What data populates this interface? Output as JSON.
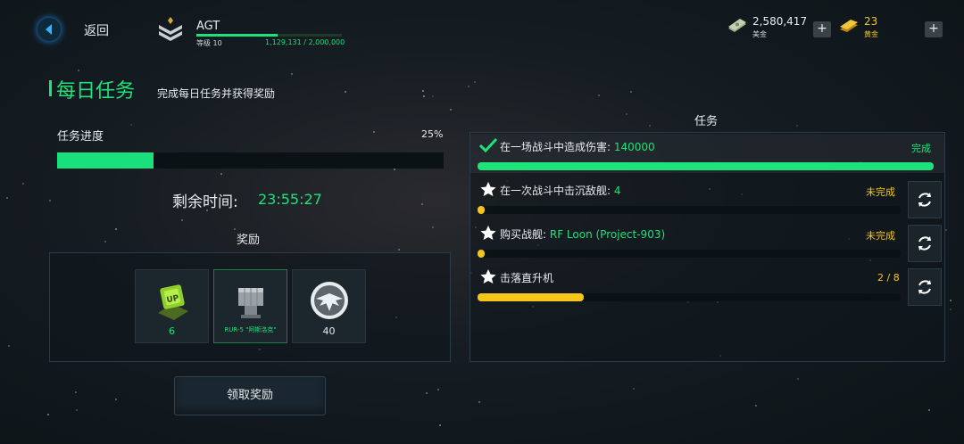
{
  "topbar": {
    "back_label": "返回",
    "player_name": "AGT",
    "level_text": "等级 10",
    "xp_text": "1,129,131 / 2,000,000",
    "xp_progress": 0.56,
    "currencies": [
      {
        "amount": "2,580,417",
        "label": "美金",
        "icon": "cash-icon"
      },
      {
        "amount": "23",
        "label": "黄金",
        "icon": "gold-bar-icon"
      }
    ]
  },
  "header": {
    "title": "每日任务",
    "subtitle": "完成每日任务并获得奖励"
  },
  "daily": {
    "progress_label": "任务进度",
    "progress_pct_text": "25%",
    "progress_value": 0.25,
    "time_label": "剩余时间:",
    "time_value": "23:55:27",
    "rewards_title": "奖励",
    "rewards": [
      {
        "icon": "container-crate-icon",
        "caption": "6"
      },
      {
        "icon": "missile-launcher-icon",
        "caption": "RUR-5 \"阿斯洛克\""
      },
      {
        "icon": "eagle-emblem-icon",
        "caption": "40"
      }
    ],
    "claim_label": "领取奖励"
  },
  "tasks": {
    "header": "任务",
    "colors": {
      "green": "#1de37a",
      "yellow": "#f5c518"
    },
    "items": [
      {
        "icon": "checkmark-icon",
        "text": "在一场战斗中造成伤害: ",
        "highlight": "140000",
        "status": "完成",
        "progress": 1.0,
        "status_color": "#1de37a",
        "refreshable": false
      },
      {
        "icon": "star-icon",
        "text": "在一次战斗中击沉敌舰: ",
        "highlight": "4",
        "status": "未完成",
        "progress": 0.0,
        "status_color": "#f5c518",
        "refreshable": true
      },
      {
        "icon": "star-icon",
        "text": "购买战舰: ",
        "highlight": "RF Loon (Project-903)",
        "status": "未完成",
        "progress": 0.0,
        "status_color": "#f5c518",
        "refreshable": true
      },
      {
        "icon": "star-icon",
        "text": "击落直升机",
        "highlight": "",
        "status": "2 / 8",
        "progress": 0.25,
        "status_color": "#f5c518",
        "refreshable": true
      }
    ]
  }
}
